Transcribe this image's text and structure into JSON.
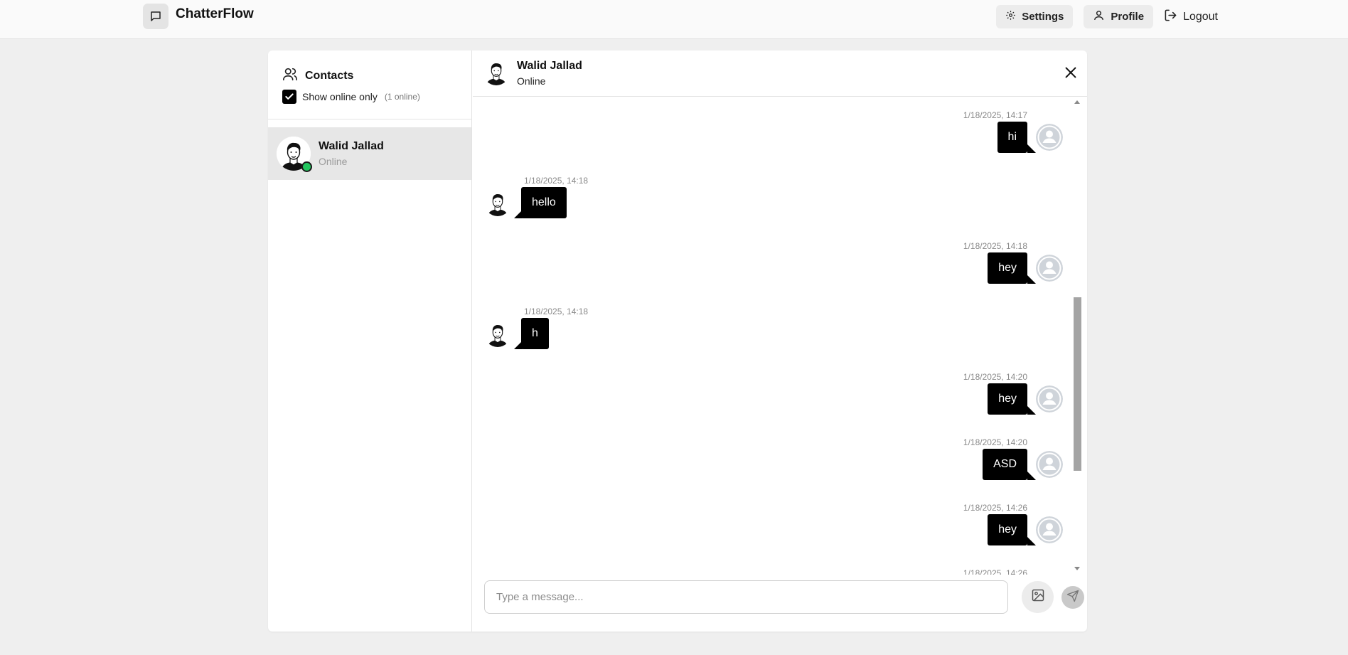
{
  "app": {
    "name": "ChatterFlow"
  },
  "nav": {
    "settings_label": "Settings",
    "profile_label": "Profile",
    "logout_label": "Logout"
  },
  "sidebar": {
    "title": "Contacts",
    "filter_label": "Show online only",
    "filter_checked": true,
    "online_count": "(1 online)",
    "contacts": [
      {
        "name": "Walid Jallad",
        "status": "Online"
      }
    ]
  },
  "chat": {
    "contact_name": "Walid Jallad",
    "contact_status": "Online",
    "messages": [
      {
        "time": "1/18/2025, 14:17",
        "text": "hi",
        "direction": "sent"
      },
      {
        "time": "1/18/2025, 14:18",
        "text": "hello",
        "direction": "received"
      },
      {
        "time": "1/18/2025, 14:18",
        "text": "hey",
        "direction": "sent"
      },
      {
        "time": "1/18/2025, 14:18",
        "text": "h",
        "direction": "received"
      },
      {
        "time": "1/18/2025, 14:20",
        "text": "hey",
        "direction": "sent"
      },
      {
        "time": "1/18/2025, 14:20",
        "text": "ASD",
        "direction": "sent"
      },
      {
        "time": "1/18/2025, 14:26",
        "text": "hey",
        "direction": "sent"
      },
      {
        "time": "1/18/2025, 14:26",
        "text": "",
        "direction": "sent"
      }
    ],
    "input_placeholder": "Type a message..."
  },
  "icons": {
    "brand": "chat-bubble-icon",
    "settings": "gear-icon",
    "profile": "user-icon",
    "logout": "logout-icon",
    "contacts": "users-icon",
    "close": "close-icon",
    "image": "image-icon",
    "send": "send-icon"
  },
  "colors": {
    "online": "#22c55e",
    "bubble": "#000000",
    "background": "#efefef"
  }
}
